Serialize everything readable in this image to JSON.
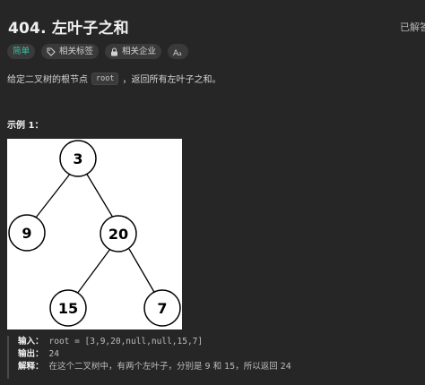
{
  "problem": {
    "title": "404. 左叶子之和",
    "solved_label": "已解答"
  },
  "tags": [
    {
      "label": "简单",
      "icon": ""
    },
    {
      "label": "相关标签",
      "icon": "tag-icon"
    },
    {
      "label": "相关企业",
      "icon": "lock-icon"
    },
    {
      "label": "",
      "icon": "font-size-icon"
    }
  ],
  "description": {
    "prefix": "给定二叉树的根节点",
    "code": "root",
    "suffix": "，返回所有左叶子之和。"
  },
  "example": {
    "title": "示例 1：",
    "tree": {
      "nodes": [
        {
          "id": "n3",
          "label": "3"
        },
        {
          "id": "n9",
          "label": "9"
        },
        {
          "id": "n20",
          "label": "20"
        },
        {
          "id": "n15",
          "label": "15"
        },
        {
          "id": "n7",
          "label": "7"
        }
      ]
    },
    "input_label": "输入：",
    "input_value": "root = [3,9,20,null,null,15,7]",
    "output_label": "输出：",
    "output_value": "24",
    "explain_label": "解释：",
    "explain_value": "在这个二叉树中，有两个左叶子，分别是 9 和 15，所以返回 24"
  }
}
